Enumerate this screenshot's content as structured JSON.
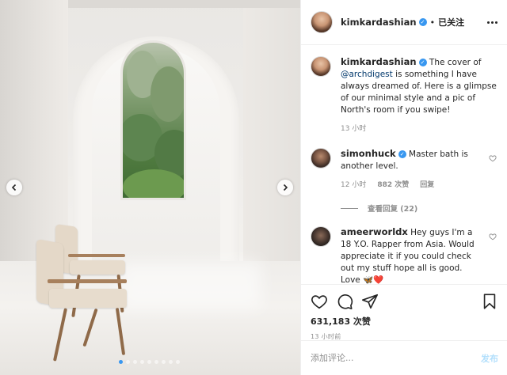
{
  "post": {
    "images_count": 9,
    "active_image_index": 0
  },
  "header": {
    "username": "kimkardashian",
    "separator": "•",
    "follow_status": "已关注"
  },
  "caption": {
    "username": "kimkardashian",
    "text_before_mention": "The cover of",
    "mention": "@archdigest",
    "text_after_mention": "is something I have always dreamed of. Here is a glimpse of our minimal style and a pic of North's room if you swipe!",
    "time": "13 小时"
  },
  "comments": [
    {
      "username": "simonhuck",
      "text": "Master bath is another level.",
      "time": "12 小时",
      "likes": "882 次赞",
      "reply_label": "回复",
      "view_replies": "查看回复 (22)"
    },
    {
      "username": "ameerworldx",
      "text": "Hey guys I'm a 18 Y.O. Rapper from Asia. Would appreciate it if you could check out my stuff hope all is good. Love 🦋❤️"
    }
  ],
  "actions": {
    "likes_count": "631,183 次赞",
    "timestamp": "13 小时前"
  },
  "comment_box": {
    "placeholder": "添加评论...",
    "post_label": "发布"
  },
  "colors": {
    "accent": "#3897f0",
    "text": "#262626",
    "muted": "#8e8e8e",
    "post_disabled": "#b2dffc"
  }
}
